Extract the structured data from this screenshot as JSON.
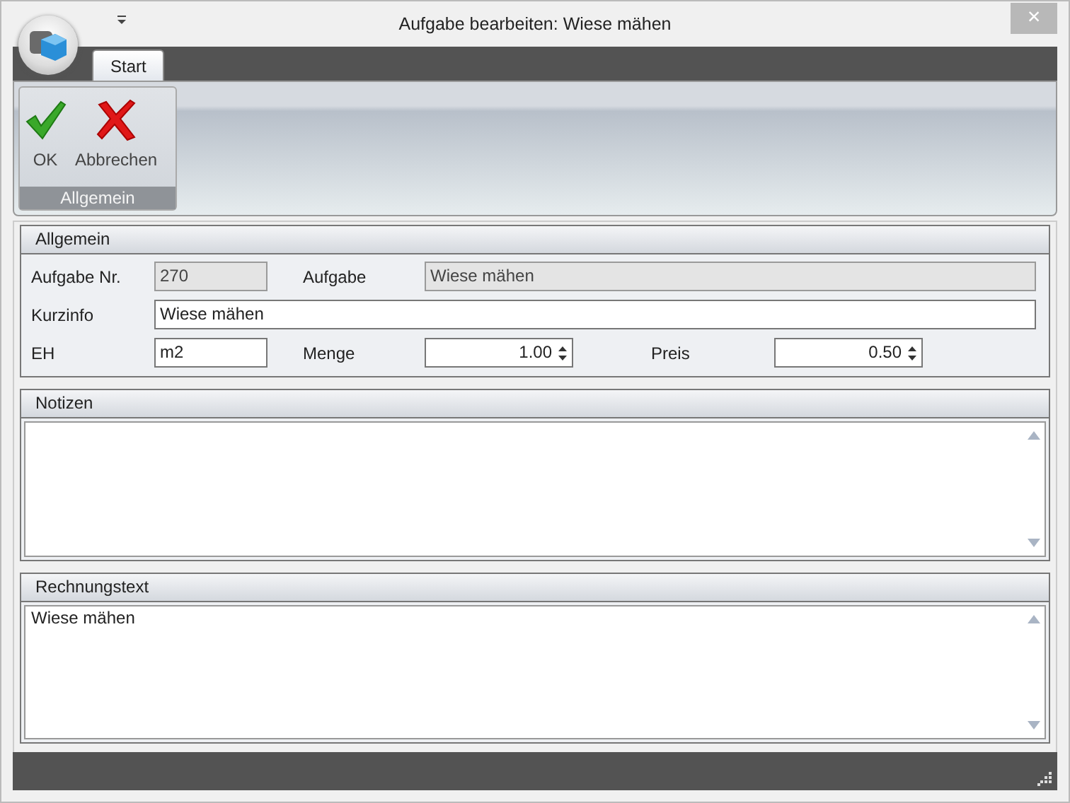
{
  "window": {
    "title": "Aufgabe bearbeiten: Wiese mähen",
    "close": "×"
  },
  "tabs": [
    {
      "label": "Start",
      "selected": true
    }
  ],
  "ribbon": {
    "group": "Allgemein",
    "buttons": [
      {
        "label": "OK",
        "kind": "ok"
      },
      {
        "label": "Abbrechen",
        "kind": "cancel"
      }
    ]
  },
  "general": {
    "title": "Allgemein",
    "rows": [
      [
        {
          "label": "Aufgabe Nr.",
          "value": "270",
          "kind": "text",
          "disabled": true
        },
        {
          "label": "Aufgabe",
          "value": "Wiese mähen",
          "kind": "text",
          "disabled": true
        }
      ],
      [
        {
          "label": "Kurzinfo",
          "value": "Wiese mähen",
          "kind": "text",
          "disabled": false
        }
      ],
      [
        {
          "label": "EH",
          "value": "m2",
          "kind": "text",
          "disabled": false
        },
        {
          "label": "Menge",
          "value": "1.00",
          "kind": "spin",
          "disabled": false
        },
        {
          "label": "Preis",
          "value": "0.50",
          "kind": "spin",
          "disabled": false
        }
      ]
    ]
  },
  "notes": [
    {
      "title": "Notizen"
    },
    {
      "title": "Rechnungstext",
      "value": "Wiese mähen"
    }
  ]
}
